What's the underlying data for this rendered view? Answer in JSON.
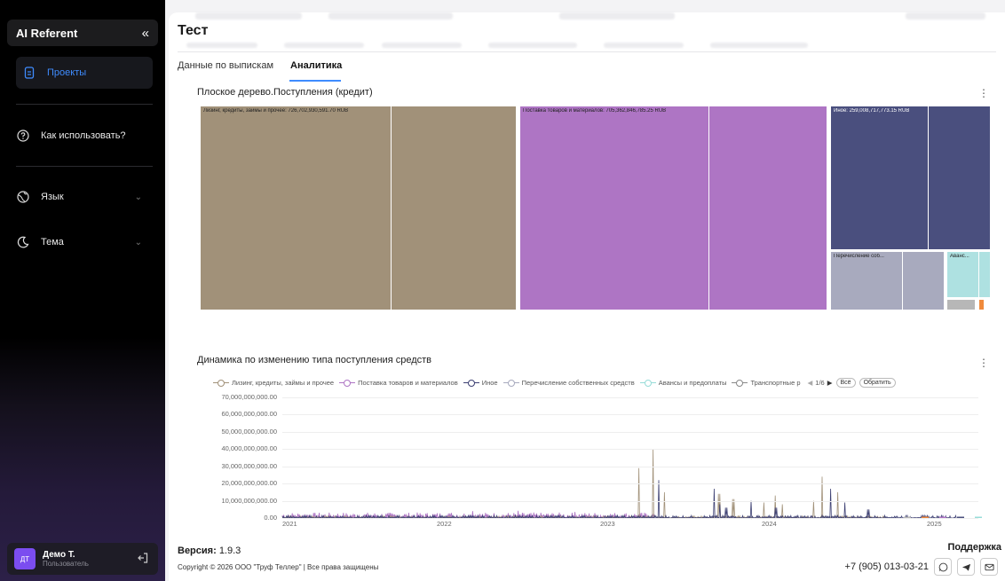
{
  "sidebar": {
    "brand": "AI Referent",
    "collapse_label": "«",
    "items": [
      {
        "label": "Проекты"
      },
      {
        "label": "Как использовать?"
      },
      {
        "label": "Язык"
      },
      {
        "label": "Тема"
      }
    ],
    "user": {
      "initials": "ДТ",
      "name": "Демо Т.",
      "role": "Пользователь"
    }
  },
  "header": {
    "title": "Тест"
  },
  "tabs": [
    {
      "label": "Данные по выпискам"
    },
    {
      "label": "Аналитика"
    }
  ],
  "treemap": {
    "title": "Плоское дерево.Поступления (кредит)",
    "labels": [
      "Лизинг, кредиты, займы и прочее: 726,702,930,591.70 RUB",
      "Поставка товаров и материалов: 705,362,846,785.25 RUB",
      "Иное: 259,008,717,773.15 RUB",
      "Перечисление соб...",
      "Аванс..."
    ],
    "colors": {
      "leasing": "#a19179",
      "supply": "#ae75c4",
      "other": "#4a4f7e",
      "transfer": "#a8aabe",
      "advance": "#aee1e1",
      "small_grey": "#b7b7b7",
      "small_orange": "#f08a3c"
    }
  },
  "dynamics": {
    "title": "Динамика по изменению типа поступления средств",
    "legend": [
      {
        "name": "Лизинг, кредиты, займы и прочее",
        "color": "#a19179"
      },
      {
        "name": "Поставка товаров и материалов",
        "color": "#ae75c4"
      },
      {
        "name": "Иное",
        "color": "#3c3f72"
      },
      {
        "name": "Перечисление собственных средств",
        "color": "#a8aabe"
      },
      {
        "name": "Авансы и предоплаты",
        "color": "#97dcd8"
      },
      {
        "name": "Транспортные р",
        "color": "#888888"
      }
    ],
    "pager": "1/6",
    "btn_all": "Всё",
    "btn_reverse": "Обратить",
    "y_ticks": [
      "70,000,000,000.00",
      "60,000,000,000.00",
      "50,000,000,000.00",
      "40,000,000,000.00",
      "30,000,000,000.00",
      "20,000,000,000.00",
      "10,000,000,000.00",
      "0.00"
    ],
    "x_ticks": [
      "2021",
      "2022",
      "2023",
      "2024",
      "2025"
    ]
  },
  "chart_data": {
    "type": "line",
    "title": "Динамика по изменению типа поступления средств",
    "x": [
      "2021",
      "2022",
      "2023",
      "2024",
      "2025"
    ],
    "ylim": [
      0,
      70000000000
    ],
    "series": [
      {
        "name": "Лизинг, кредиты, займы и прочее",
        "peaks": [
          {
            "x": "2023-05",
            "y": 40000000000
          },
          {
            "x": "2023-04",
            "y": 29000000000
          },
          {
            "x": "2024-02",
            "y": 24000000000
          }
        ]
      },
      {
        "name": "Поставка товаров и материалов",
        "peaks": [
          {
            "x": "2022-10",
            "y": 4000000000
          },
          {
            "x": "2023-01",
            "y": 3500000000
          }
        ]
      },
      {
        "name": "Иное",
        "peaks": [
          {
            "x": "2023-10",
            "y": 22000000000
          },
          {
            "x": "2023-09",
            "y": 17000000000
          }
        ]
      }
    ]
  },
  "footer": {
    "version_label": "Версия:",
    "version": "1.9.3",
    "copyright": "Copyright © 2026 ООО \"Труф Теллер\" | Все права защищены",
    "support": "Поддержка",
    "phone": "+7 (905) 013-03-21"
  }
}
